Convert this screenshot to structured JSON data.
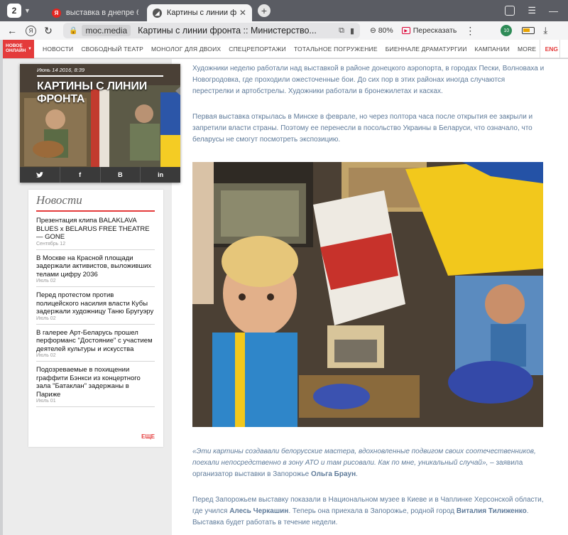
{
  "browser": {
    "tab_count": "2",
    "tabs": [
      {
        "title": "выставка в днепре белор",
        "favicon": "Я",
        "favicon_color": "#e52620",
        "active": false
      },
      {
        "title": "Картины с линии фронта",
        "favicon": "◢",
        "favicon_color": "#555555",
        "active": true
      }
    ],
    "new_tab": "+",
    "url_domain": "moc.media",
    "page_title": "Картины с линии фронта :: Министерство...",
    "zoom": "80%",
    "translate_label": "Пересказать",
    "extension_badge": "10"
  },
  "site": {
    "logo_line1": "НОВОЕ",
    "logo_line2": "ОНЛАЙН",
    "nav": [
      "НОВОСТИ",
      "СВОБОДНЫЙ ТЕАТР",
      "МОНОЛОГ ДЛЯ ДВОИХ",
      "СПЕЦРЕПОРТАЖИ",
      "ТОТАЛЬНОЕ ПОГРУЖЕНИЕ",
      "БИЕННАЛЕ ДРАМАТУРГИИ",
      "КАМПАНИИ",
      "MORE"
    ],
    "lang": "ENG",
    "accent_color": "#e43b3b"
  },
  "hero": {
    "date": "Июнь 14 2016, 8:39",
    "title": "КАРТИНЫ С ЛИНИИ ФРОНТА",
    "share": [
      "t-icon",
      "f",
      "В",
      "in"
    ]
  },
  "news": {
    "heading": "Новости",
    "items": [
      {
        "title": "Презентация клипа BALAKLAVA BLUES x BELARUS FREE THEATRE — GONE",
        "date": "Сентябрь 12"
      },
      {
        "title": "В Москве на Красной площади задержали активистов, выложивших телами цифру 2036",
        "date": "Июль 02"
      },
      {
        "title": "Перед протестом против полицейского насилия власти Кубы задержали художницу Таню Бругуэру",
        "date": "Июль 02"
      },
      {
        "title": "В галерее Арт-Беларусь прошел перформанс \"Достояние\" с участием деятелей культуры и искусства",
        "date": "Июль 02"
      },
      {
        "title": "Подозреваемые в похищении граффити Бэнкси из концертного зала \"Батаклан\" задержаны в Париже",
        "date": "Июль 01"
      }
    ],
    "more": "ЕЩЕ"
  },
  "article": {
    "p1": "Художники неделю работали над выставкой в районе донецкого аэропорта, в городах Пески, Волноваха и Новогродовка, где проходили ожесточенные бои. До сих пор в этих районах иногда случаются перестрелки и артобстрелы. Художники работали в бронежилетах и касках.",
    "p2": "Первая выставка открылась в Минске в феврале, но через полтора часа после открытия ее закрыли и запретили власти страны. Поэтому ее перенесли в посольство Украины в Беларуси, что означало, что беларусы не смогут посмотреть экспозицию.",
    "quote_text": "«Эти картины создавали белорусские мастера, вдохновленные подвигом своих соотечественников, поехали непосредственно в зону АТО и там рисовали. Как по мне, уникальный случай»,",
    "quote_attr": " – заявила организатор выставки в Запорожье ",
    "quote_name": "Ольга Браун",
    "quote_end": ".",
    "p4_a": "Перед Запорожьем выставку показали в Национальном музее в Киеве и в Чаплинке Херсонской области, где учился ",
    "p4_name1": "Алесь Черкашин",
    "p4_b": ". Теперь она приехала в Запорожье, родной город ",
    "p4_name2": "Виталия Тилиженко",
    "p4_c": ". Выставка будет работать в течение недели."
  }
}
